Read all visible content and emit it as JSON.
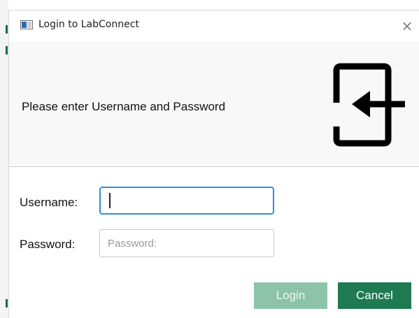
{
  "window": {
    "title": "Login to LabConnect",
    "close_symbol": "×",
    "title_icon": "window-app-icon"
  },
  "header": {
    "prompt": "Please enter Username and Password",
    "icon": "login-icon"
  },
  "form": {
    "username_label": "Username:",
    "username_value": "",
    "password_label": "Password:",
    "password_placeholder": "Password:",
    "password_value": ""
  },
  "buttons": {
    "login_label": "Login",
    "cancel_label": "Cancel"
  },
  "colors": {
    "accent_green": "#1f7a52",
    "disabled_green": "#8dc4a9",
    "focus_blue": "#2f8fd8"
  }
}
